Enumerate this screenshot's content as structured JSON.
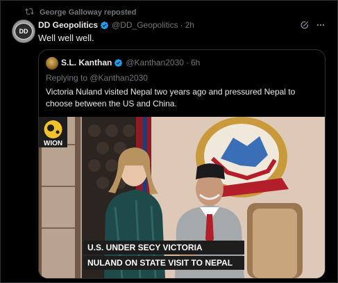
{
  "repost": {
    "text": "George Galloway reposted",
    "icon": "repost-icon"
  },
  "tweet": {
    "avatar_text": "DD",
    "name": "DD Geopolitics",
    "handle": "@DD_Geopolitics",
    "separator": "·",
    "time": "2h",
    "text": "Well well well.",
    "verified_color": "#1d9bf0",
    "icons": [
      "grok-icon",
      "more-icon"
    ]
  },
  "quote": {
    "name": "S.L. Kanthan",
    "handle": "@Kanthan2030",
    "separator": "·",
    "time": "6h",
    "replying": "Replying to @Kanthan2030",
    "text": "Victoria Nuland visited Nepal two years ago and pressured Nepal to choose between the US and China.",
    "media": {
      "logo": "WION",
      "headline_1": "U.S. UNDER SECY VICTORIA",
      "headline_2": "NULAND ON STATE VISIT TO NEPAL"
    }
  },
  "colors": {
    "background": "#000000",
    "text": "#e7e9ea",
    "muted": "#71767b",
    "border": "#2f3336",
    "accent": "#1d9bf0"
  }
}
